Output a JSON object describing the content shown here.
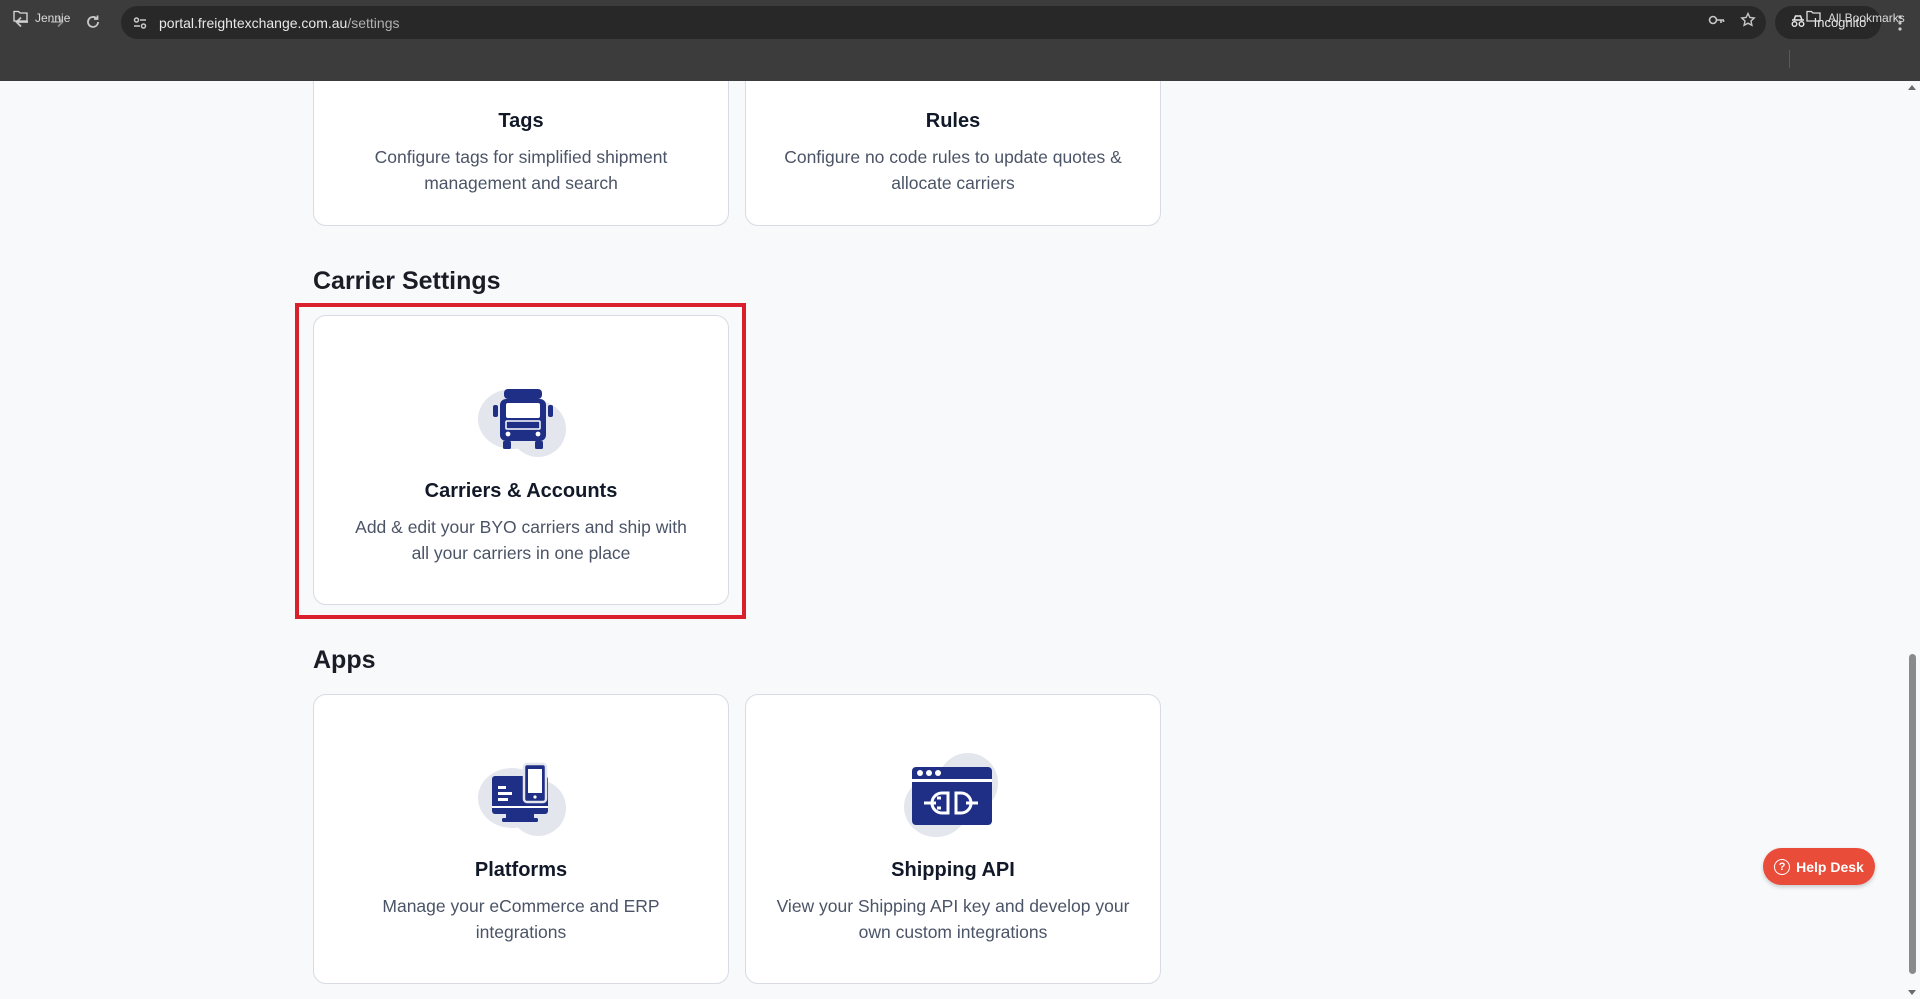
{
  "browser": {
    "url_host": "portal.freightexchange.com.au",
    "url_path": "/settings",
    "incognito_label": "Incognito",
    "bookmark_left": "Jennie",
    "bookmark_right": "All Bookmarks"
  },
  "cards_top": [
    {
      "title": "Tags",
      "description": "Configure tags for simplified shipment management and search"
    },
    {
      "title": "Rules",
      "description": "Configure no code rules to update quotes & allocate carriers"
    }
  ],
  "carrier_section": {
    "title": "Carrier Settings",
    "card": {
      "title": "Carriers & Accounts",
      "description": "Add & edit your BYO carriers and ship with all your carriers in one place",
      "icon": "truck-icon"
    }
  },
  "apps_section": {
    "title": "Apps",
    "cards": [
      {
        "title": "Platforms",
        "description": "Manage your eCommerce and ERP integrations",
        "icon": "devices-icon"
      },
      {
        "title": "Shipping API",
        "description": "View your Shipping API key and develop your own custom integrations",
        "icon": "api-plug-icon"
      }
    ]
  },
  "help_desk": {
    "label": "Help Desk"
  },
  "colors": {
    "icon_navy": "#1f2f86",
    "icon_blob": "#e4e6ee",
    "highlight": "#d9202c",
    "help_desk": "#ea4c3a"
  }
}
